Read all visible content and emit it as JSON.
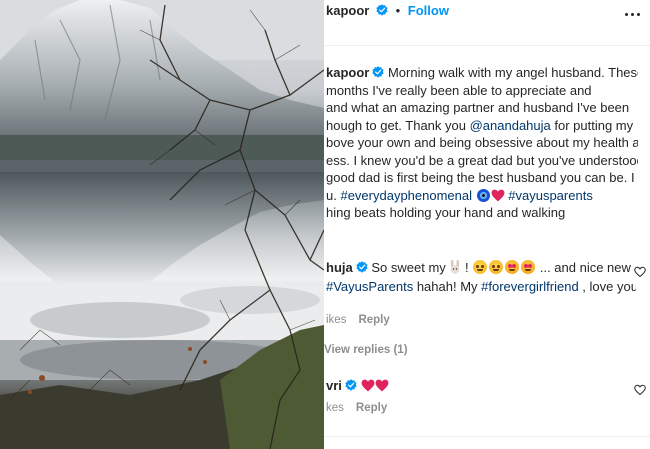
{
  "post": {
    "header_username": "kapoor",
    "separator": "•",
    "follow_label": "Follow"
  },
  "caption": {
    "username": "kapoor",
    "line1": "Morning walk with my angel husband. These",
    "line2": " months I've really been able to appreciate and",
    "line3": "and what an amazing partner and husband I've been",
    "line4_a": "hough to get. Thank you ",
    "mention": "@anandahuja",
    "line4_b": " for putting my",
    "line5": "bove your own and being obsessive about my health and",
    "line6": "ess. I knew you'd be a great dad but you've understood",
    "line7": " good dad is first being the best husband you can be. I",
    "line8_a": "u. ",
    "hashtag1": "#everydayphenomenal",
    "hashtag2": "#vayusparents",
    "tail": "hing beats holding your hand and walking"
  },
  "comments": [
    {
      "username": "huja",
      "text_a": " So sweet my ",
      "text_b": " ! ",
      "text_c": " ... and nice new",
      "line2_a": "#VayusParents",
      "line2_b": " hahah! My ",
      "line2_c": "#forevergirlfriend",
      "line2_d": " , love you",
      "likes": "ikes",
      "reply": "Reply",
      "view_replies": "View replies (1)"
    },
    {
      "username": "vri",
      "likes": "kes",
      "reply": "Reply"
    }
  ],
  "colors": {
    "link_blue": "#0095f6",
    "hashtag": "#00376b",
    "verified": "#0095f6",
    "heart_red": "#e0245e",
    "muted": "#8e8e8e"
  },
  "icons": [
    "verified-badge-icon",
    "more-options-icon",
    "heart-icon",
    "evil-eye-emoji",
    "red-heart-emoji",
    "bunny-emoji",
    "face-emoji"
  ]
}
